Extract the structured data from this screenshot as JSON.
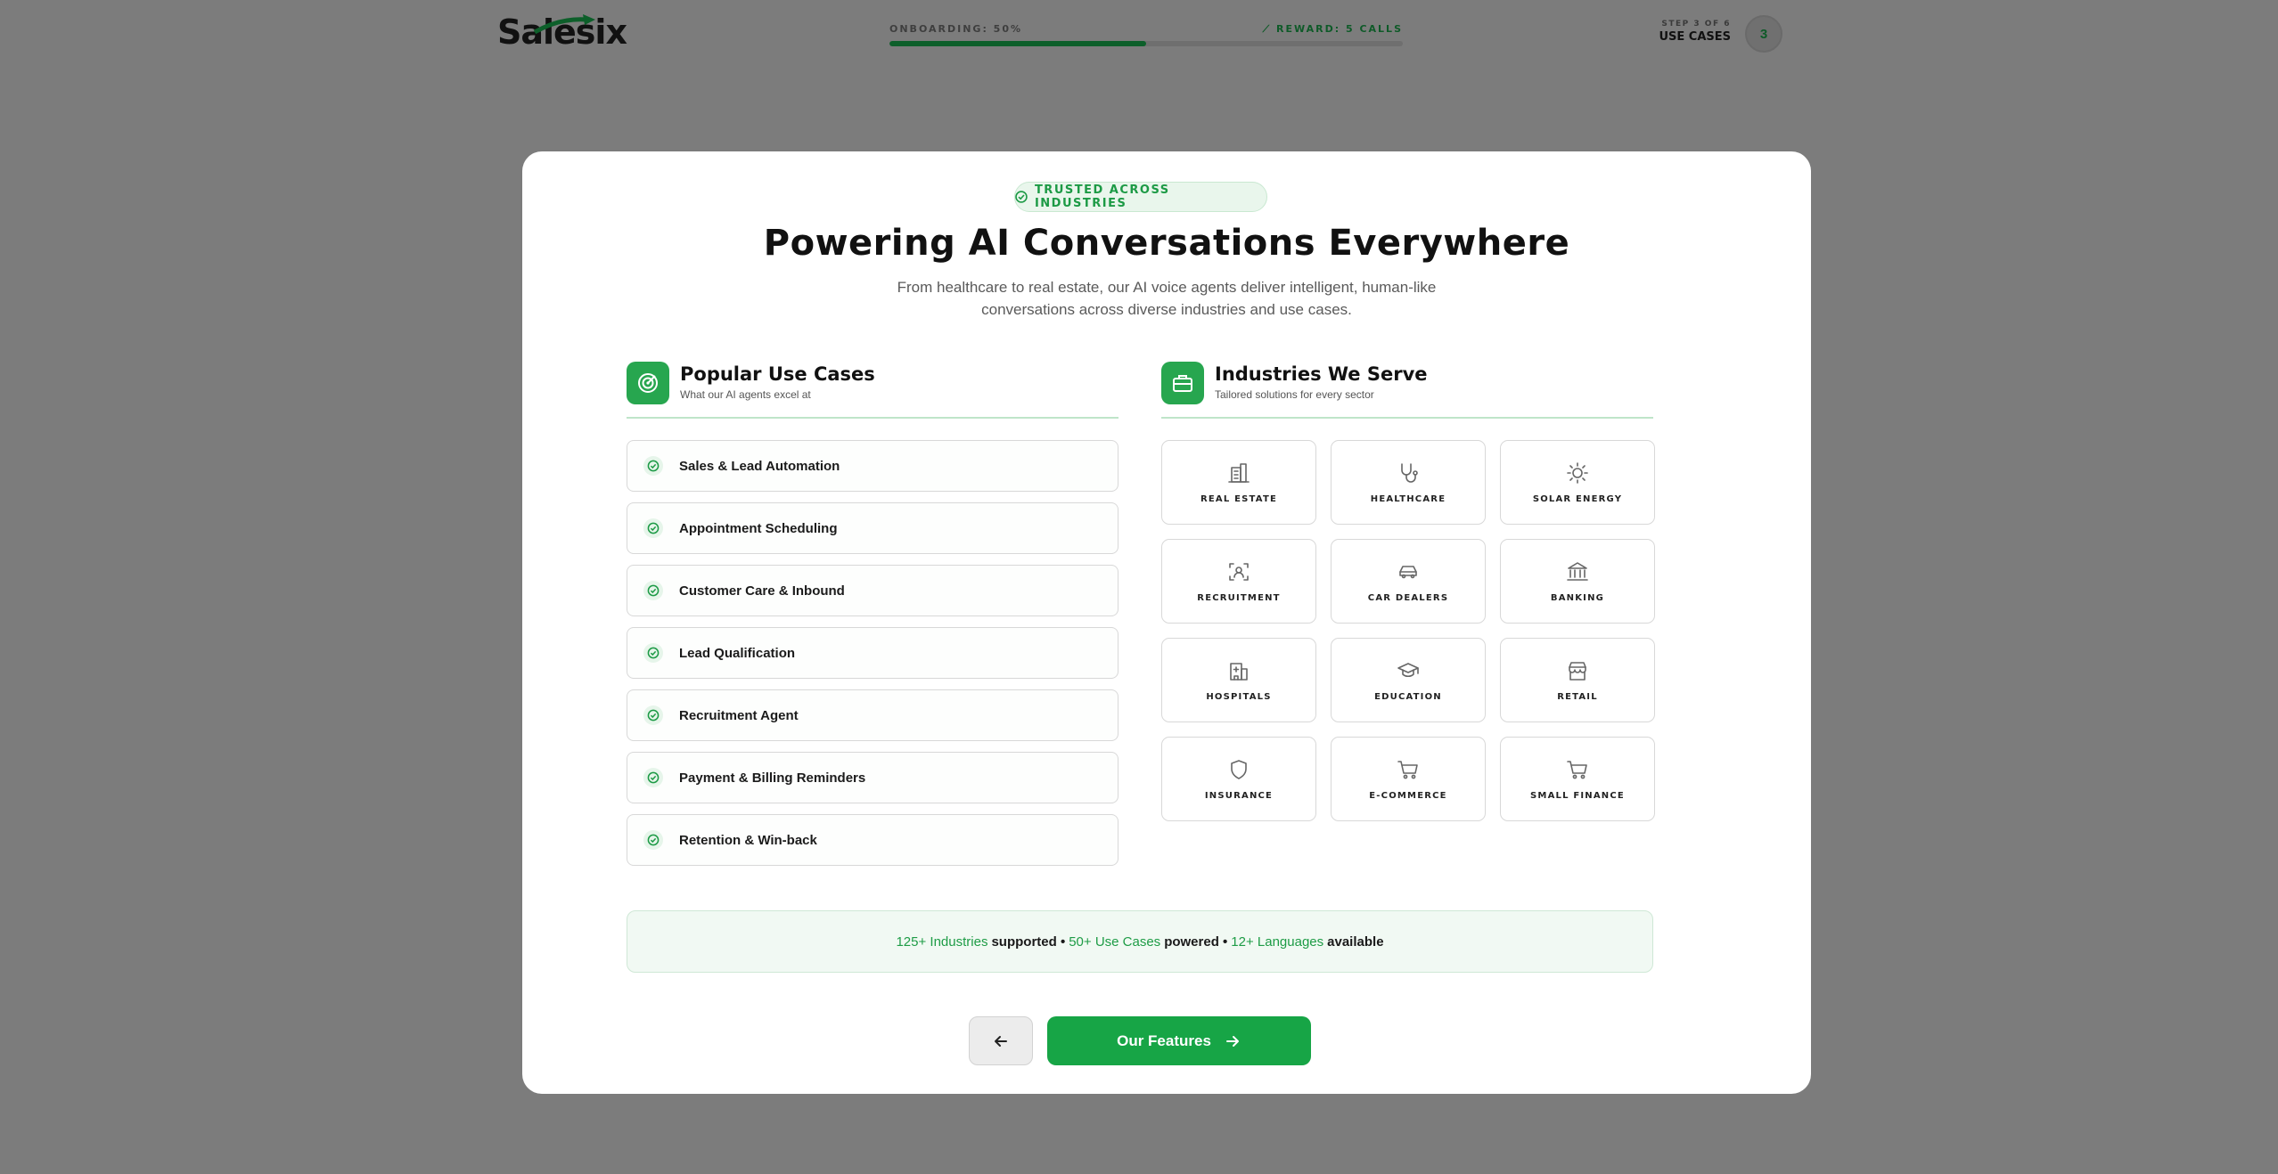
{
  "header": {
    "logo_text": "Salesix",
    "progress_label": "ONBOARDING: 50%",
    "progress_value": 0.5,
    "reward_label": "REWARD: 5 CALLS",
    "step_small": "STEP 3 OF 6",
    "step_title": "USE CASES",
    "step_number": "3"
  },
  "modal": {
    "badge": "TRUSTED ACROSS INDUSTRIES",
    "title": "Powering AI Conversations Everywhere",
    "subtitle": "From healthcare to real estate, our AI voice agents deliver intelligent, human-like conversations across diverse industries and use cases.",
    "use_cases": {
      "title": "Popular Use Cases",
      "subtitle": "What our AI agents excel at",
      "items": [
        {
          "label": "Sales & Lead Automation"
        },
        {
          "label": "Appointment Scheduling"
        },
        {
          "label": "Customer Care & Inbound"
        },
        {
          "label": "Lead Qualification"
        },
        {
          "label": "Recruitment Agent"
        },
        {
          "label": "Payment & Billing Reminders"
        },
        {
          "label": "Retention & Win-back"
        }
      ]
    },
    "industries": {
      "title": "Industries We Serve",
      "subtitle": "Tailored solutions for every sector",
      "items": [
        {
          "label": "REAL ESTATE",
          "icon": "building-icon"
        },
        {
          "label": "HEALTHCARE",
          "icon": "stethoscope-icon"
        },
        {
          "label": "SOLAR ENERGY",
          "icon": "sun-icon"
        },
        {
          "label": "RECRUITMENT",
          "icon": "user-scan-icon"
        },
        {
          "label": "CAR DEALERS",
          "icon": "car-icon"
        },
        {
          "label": "BANKING",
          "icon": "bank-icon"
        },
        {
          "label": "HOSPITALS",
          "icon": "hospital-icon"
        },
        {
          "label": "EDUCATION",
          "icon": "graduation-cap-icon"
        },
        {
          "label": "RETAIL",
          "icon": "store-icon"
        },
        {
          "label": "INSURANCE",
          "icon": "shield-icon"
        },
        {
          "label": "E-COMMERCE",
          "icon": "cart-icon"
        },
        {
          "label": "SMALL FINANCE",
          "icon": "cart-icon"
        }
      ]
    },
    "stats": {
      "industries": "125+ Industries",
      "industries_suffix": "supported •",
      "use_cases": "50+ Use Cases",
      "use_cases_suffix": "powered •",
      "languages": "12+ Languages",
      "languages_suffix": "available"
    },
    "next_button": "Our Features"
  },
  "colors": {
    "accent": "#17a546",
    "overlay": "#7c7c7c"
  }
}
